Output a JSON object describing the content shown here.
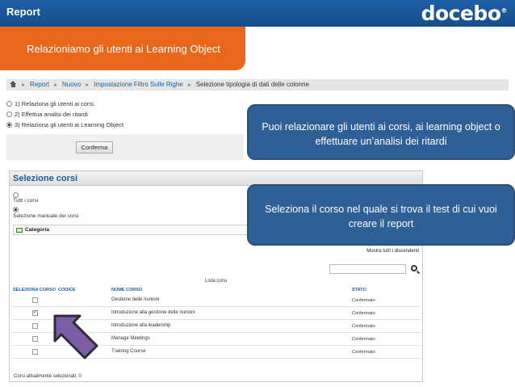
{
  "header": {
    "title": "Report",
    "logo": "docebo",
    "logo_mark": "®"
  },
  "banner": {
    "text": "Relazioniamo gli utenti ai Learning Object"
  },
  "breadcrumb": {
    "items": [
      "Report",
      "Nuovo",
      "Impostazione Filtro Sulle Righe"
    ],
    "current": "Selezione tipologia di dati delle colonne"
  },
  "report_type": {
    "options": [
      {
        "label": "1) Relaziona gli utenti ai corsi.",
        "selected": false
      },
      {
        "label": "2) Effettua analisi dei ritardi",
        "selected": false
      },
      {
        "label": "3) Relaziona gli utenti ai Learning Object",
        "selected": true
      }
    ],
    "confirm_label": "Conferma"
  },
  "course_panel": {
    "title": "Selezione corsi",
    "all_label": "Tutti i corsi",
    "manual_label": "Selezione manuale dei corsi",
    "category_label": "Categoria",
    "show_all_label": "Mostra tutti i discendenti",
    "list_title": "Lista corsi",
    "columns": {
      "select": "SELEZIONA CORSO",
      "code": "CODICE",
      "name": "NOME CORSO",
      "state": "STATO"
    },
    "rows": [
      {
        "name": "Gestione delle riunioni",
        "state": "Confermato",
        "checked": false
      },
      {
        "name": "Introduzione alla gestione delle riunioni",
        "state": "Confermato",
        "checked": true
      },
      {
        "name": "Introduzione alla leadership",
        "state": "Confermato",
        "checked": false
      },
      {
        "name": "Manage Meetings",
        "state": "Confermato",
        "checked": false
      },
      {
        "name": "Training Course",
        "state": "Confermato",
        "checked": false
      }
    ],
    "selected_count_label": "Corsi attualmente selezionati: 0"
  },
  "callouts": {
    "top": "Puoi relazionare gli utenti ai corsi, ai learning object o effettuare un’analisi dei ritardi",
    "bottom": "Seleziona il corso nel quale si trova il test di cui vuoi creare il report"
  },
  "colors": {
    "header_blue": "#1d5fa6",
    "banner_orange": "#e8671a",
    "callout_blue": "#2e5f97",
    "arrow_purple": "#7b5ea7"
  }
}
